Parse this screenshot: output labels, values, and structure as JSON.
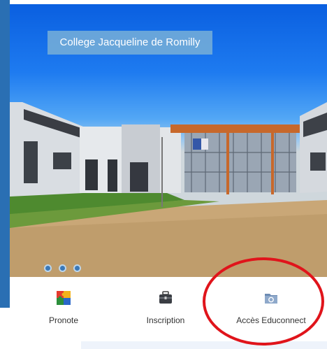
{
  "hero": {
    "title": "College Jacqueline de Romilly",
    "carousel_dots": 3
  },
  "nav": {
    "items": [
      {
        "label": "Pronote",
        "icon": "pronote-puzzle-icon"
      },
      {
        "label": "Inscription",
        "icon": "briefcase-icon"
      },
      {
        "label": "Accès Educonnect",
        "icon": "educonnect-folder-icon"
      }
    ]
  },
  "colors": {
    "sky": "#1e7bf0",
    "annotation_circle": "#e0141b",
    "title_box": "#78afd7"
  }
}
